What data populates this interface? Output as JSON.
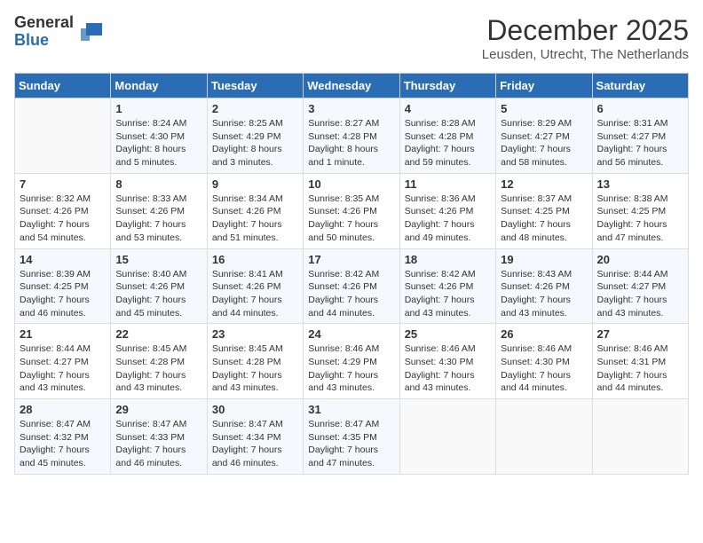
{
  "logo": {
    "general": "General",
    "blue": "Blue"
  },
  "title": {
    "month": "December 2025",
    "location": "Leusden, Utrecht, The Netherlands"
  },
  "weekdays": [
    "Sunday",
    "Monday",
    "Tuesday",
    "Wednesday",
    "Thursday",
    "Friday",
    "Saturday"
  ],
  "weeks": [
    [
      {
        "day": "",
        "info": ""
      },
      {
        "day": "1",
        "info": "Sunrise: 8:24 AM\nSunset: 4:30 PM\nDaylight: 8 hours\nand 5 minutes."
      },
      {
        "day": "2",
        "info": "Sunrise: 8:25 AM\nSunset: 4:29 PM\nDaylight: 8 hours\nand 3 minutes."
      },
      {
        "day": "3",
        "info": "Sunrise: 8:27 AM\nSunset: 4:28 PM\nDaylight: 8 hours\nand 1 minute."
      },
      {
        "day": "4",
        "info": "Sunrise: 8:28 AM\nSunset: 4:28 PM\nDaylight: 7 hours\nand 59 minutes."
      },
      {
        "day": "5",
        "info": "Sunrise: 8:29 AM\nSunset: 4:27 PM\nDaylight: 7 hours\nand 58 minutes."
      },
      {
        "day": "6",
        "info": "Sunrise: 8:31 AM\nSunset: 4:27 PM\nDaylight: 7 hours\nand 56 minutes."
      }
    ],
    [
      {
        "day": "7",
        "info": "Sunrise: 8:32 AM\nSunset: 4:26 PM\nDaylight: 7 hours\nand 54 minutes."
      },
      {
        "day": "8",
        "info": "Sunrise: 8:33 AM\nSunset: 4:26 PM\nDaylight: 7 hours\nand 53 minutes."
      },
      {
        "day": "9",
        "info": "Sunrise: 8:34 AM\nSunset: 4:26 PM\nDaylight: 7 hours\nand 51 minutes."
      },
      {
        "day": "10",
        "info": "Sunrise: 8:35 AM\nSunset: 4:26 PM\nDaylight: 7 hours\nand 50 minutes."
      },
      {
        "day": "11",
        "info": "Sunrise: 8:36 AM\nSunset: 4:26 PM\nDaylight: 7 hours\nand 49 minutes."
      },
      {
        "day": "12",
        "info": "Sunrise: 8:37 AM\nSunset: 4:25 PM\nDaylight: 7 hours\nand 48 minutes."
      },
      {
        "day": "13",
        "info": "Sunrise: 8:38 AM\nSunset: 4:25 PM\nDaylight: 7 hours\nand 47 minutes."
      }
    ],
    [
      {
        "day": "14",
        "info": "Sunrise: 8:39 AM\nSunset: 4:25 PM\nDaylight: 7 hours\nand 46 minutes."
      },
      {
        "day": "15",
        "info": "Sunrise: 8:40 AM\nSunset: 4:26 PM\nDaylight: 7 hours\nand 45 minutes."
      },
      {
        "day": "16",
        "info": "Sunrise: 8:41 AM\nSunset: 4:26 PM\nDaylight: 7 hours\nand 44 minutes."
      },
      {
        "day": "17",
        "info": "Sunrise: 8:42 AM\nSunset: 4:26 PM\nDaylight: 7 hours\nand 44 minutes."
      },
      {
        "day": "18",
        "info": "Sunrise: 8:42 AM\nSunset: 4:26 PM\nDaylight: 7 hours\nand 43 minutes."
      },
      {
        "day": "19",
        "info": "Sunrise: 8:43 AM\nSunset: 4:26 PM\nDaylight: 7 hours\nand 43 minutes."
      },
      {
        "day": "20",
        "info": "Sunrise: 8:44 AM\nSunset: 4:27 PM\nDaylight: 7 hours\nand 43 minutes."
      }
    ],
    [
      {
        "day": "21",
        "info": "Sunrise: 8:44 AM\nSunset: 4:27 PM\nDaylight: 7 hours\nand 43 minutes."
      },
      {
        "day": "22",
        "info": "Sunrise: 8:45 AM\nSunset: 4:28 PM\nDaylight: 7 hours\nand 43 minutes."
      },
      {
        "day": "23",
        "info": "Sunrise: 8:45 AM\nSunset: 4:28 PM\nDaylight: 7 hours\nand 43 minutes."
      },
      {
        "day": "24",
        "info": "Sunrise: 8:46 AM\nSunset: 4:29 PM\nDaylight: 7 hours\nand 43 minutes."
      },
      {
        "day": "25",
        "info": "Sunrise: 8:46 AM\nSunset: 4:30 PM\nDaylight: 7 hours\nand 43 minutes."
      },
      {
        "day": "26",
        "info": "Sunrise: 8:46 AM\nSunset: 4:30 PM\nDaylight: 7 hours\nand 44 minutes."
      },
      {
        "day": "27",
        "info": "Sunrise: 8:46 AM\nSunset: 4:31 PM\nDaylight: 7 hours\nand 44 minutes."
      }
    ],
    [
      {
        "day": "28",
        "info": "Sunrise: 8:47 AM\nSunset: 4:32 PM\nDaylight: 7 hours\nand 45 minutes."
      },
      {
        "day": "29",
        "info": "Sunrise: 8:47 AM\nSunset: 4:33 PM\nDaylight: 7 hours\nand 46 minutes."
      },
      {
        "day": "30",
        "info": "Sunrise: 8:47 AM\nSunset: 4:34 PM\nDaylight: 7 hours\nand 46 minutes."
      },
      {
        "day": "31",
        "info": "Sunrise: 8:47 AM\nSunset: 4:35 PM\nDaylight: 7 hours\nand 47 minutes."
      },
      {
        "day": "",
        "info": ""
      },
      {
        "day": "",
        "info": ""
      },
      {
        "day": "",
        "info": ""
      }
    ]
  ]
}
